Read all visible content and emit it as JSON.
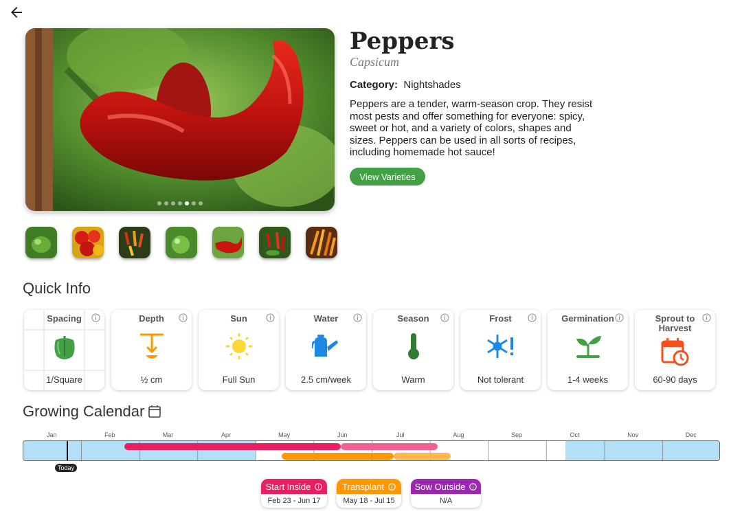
{
  "header": {
    "back_icon": "arrow-left-icon"
  },
  "plant": {
    "name": "Peppers",
    "latin": "Capsicum",
    "category_label": "Category:",
    "category": "Nightshades",
    "description": "Peppers are a tender, warm-season crop. They resist most pests and offer something for everyone: spicy, sweet or hot, and a variety of colors, shapes and sizes. Peppers can be used in all sorts of recipes, including homemade hot sauce!",
    "view_button": "View Varieties"
  },
  "gallery": {
    "dot_count": 7,
    "active_dot": 5,
    "thumb_count": 7
  },
  "quick_info": {
    "title": "Quick Info",
    "cards": [
      {
        "label": "Spacing",
        "value": "1/Square",
        "icon": "pepper-icon"
      },
      {
        "label": "Depth",
        "value": "½ cm",
        "icon": "depth-icon"
      },
      {
        "label": "Sun",
        "value": "Full Sun",
        "icon": "sun-icon"
      },
      {
        "label": "Water",
        "value": "2.5 cm/week",
        "icon": "watering-can-icon"
      },
      {
        "label": "Season",
        "value": "Warm",
        "icon": "thermometer-icon"
      },
      {
        "label": "Frost",
        "value": "Not tolerant",
        "icon": "frost-icon"
      },
      {
        "label": "Germination",
        "value": "1-4 weeks",
        "icon": "sprout-icon"
      },
      {
        "label": "Sprout to Harvest",
        "value": "60-90 days",
        "icon": "calendar-clock-icon"
      }
    ]
  },
  "calendar": {
    "title": "Growing Calendar",
    "months": [
      "Jan",
      "Feb",
      "Mar",
      "Apr",
      "May",
      "Jun",
      "Jul",
      "Aug",
      "Sep",
      "Oct",
      "Nov",
      "Dec"
    ],
    "today_label": "Today",
    "legend": [
      {
        "label": "Start Inside",
        "range": "Feb 23 - Jun 17",
        "color": "#e91e63"
      },
      {
        "label": "Transplant",
        "range": "May 18 - Jul 15",
        "color": "#ff9800"
      },
      {
        "label": "Sow Outside",
        "range": "N/A",
        "color": "#9c27b0"
      }
    ],
    "colors": {
      "frost": "#b3e0f7",
      "start_inside": "#e91e63",
      "transplant": "#ff9800"
    }
  }
}
